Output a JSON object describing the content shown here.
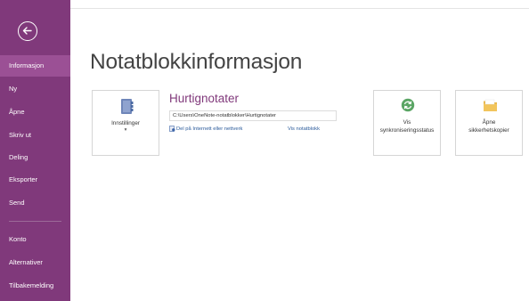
{
  "sidebar": {
    "items": [
      {
        "label": "Informasjon",
        "selected": true
      },
      {
        "label": "Ny"
      },
      {
        "label": "Åpne"
      },
      {
        "label": "Skriv ut"
      },
      {
        "label": "Deling"
      },
      {
        "label": "Eksporter"
      },
      {
        "label": "Send"
      }
    ],
    "bottom_items": [
      {
        "label": "Konto"
      },
      {
        "label": "Alternativer"
      },
      {
        "label": "Tilbakemelding"
      }
    ]
  },
  "main": {
    "title": "Notatblokkinformasjon",
    "settings_tile": {
      "label": "Innstillinger",
      "chevron": "▾"
    },
    "notebook": {
      "name": "Hurtignotater",
      "path": "C:\\Users\\OneNote-notatblokker\\Hurtignotater",
      "share_link": "Del på Internett eller nettverk",
      "view_link": "Vis notatblokk"
    },
    "sync_tile": {
      "line1": "Vis",
      "line2": "synkroniseringsstatus"
    },
    "backup_tile": {
      "line1": "Åpne",
      "line2": "sikkerhetskopier"
    }
  },
  "colors": {
    "accent": "#80397b",
    "sidebar_selected": "#9b5095",
    "link": "#2a5a9a",
    "sync_green": "#5aa564",
    "folder_yellow": "#f2c55c"
  }
}
